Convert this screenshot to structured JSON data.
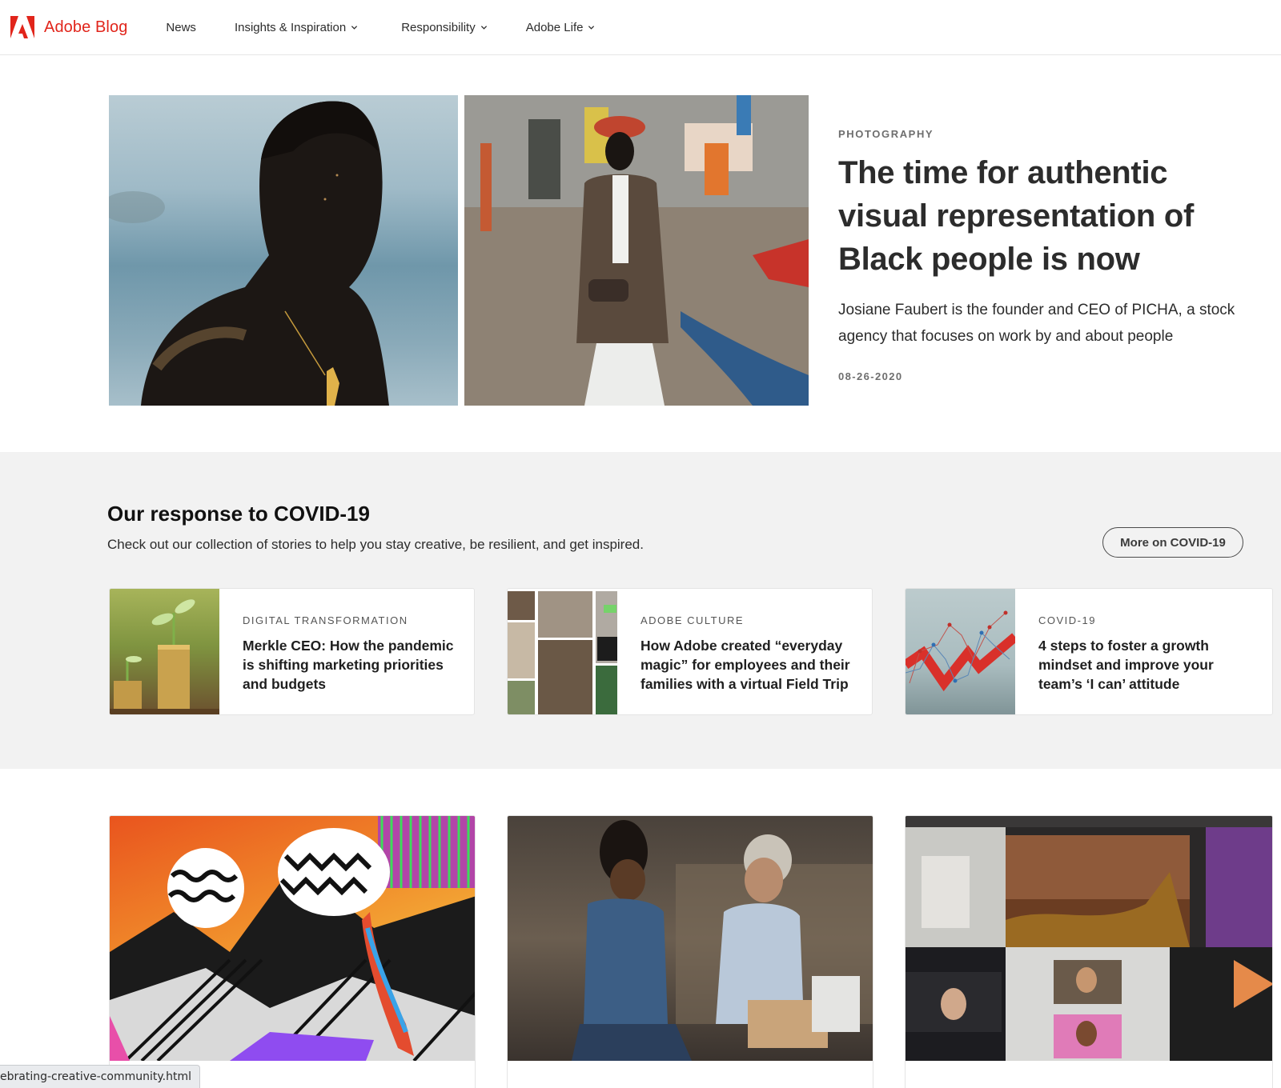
{
  "colors": {
    "brand": "#e1251b",
    "text": "#2c2c2c",
    "muted": "#6e6e6e",
    "band": "#f2f2f2"
  },
  "nav": {
    "brand": "Adobe Blog",
    "logo_icon": "adobe-logo-icon",
    "items": [
      {
        "label": "News",
        "has_dropdown": false
      },
      {
        "label": "Insights & Inspiration",
        "has_dropdown": true
      },
      {
        "label": "Responsibility",
        "has_dropdown": true
      },
      {
        "label": "Adobe Life",
        "has_dropdown": true
      }
    ]
  },
  "hero": {
    "category": "PHOTOGRAPHY",
    "title": "The time for authentic visual representation of Black people is now",
    "description": "Josiane Faubert is the founder and CEO of PICHA, a stock agency that focuses on work by and about people",
    "date": "08-26-2020",
    "images": [
      {
        "alt": "Portrait of a man with sand on his face by the sea"
      },
      {
        "alt": "Man in a brown blazer and red beret standing by a wall and boat"
      }
    ]
  },
  "covid": {
    "title": "Our response to COVID-19",
    "subtitle": "Check out our collection of stories to help you stay creative, be resilient, and get inspired.",
    "more_button": "More on COVID-19",
    "cards": [
      {
        "category": "DIGITAL TRANSFORMATION",
        "title": "Merkle CEO: How the pandemic is shifting marketing priorities and budgets",
        "thumb": "seedlings-on-coins"
      },
      {
        "category": "ADOBE CULTURE",
        "title": "How Adobe created “everyday magic” for employees and their families with a virtual Field Trip",
        "thumb": "photo-collage"
      },
      {
        "category": "COVID-19",
        "title": "4 steps to foster a growth mindset and improve your team’s ‘I can’ attitude",
        "thumb": "growth-chart"
      }
    ]
  },
  "grid": {
    "tiles": [
      {
        "thumb": "abstract-op-art-mountains"
      },
      {
        "thumb": "two-people-packing-boxes"
      },
      {
        "thumb": "video-call-creative-apps"
      }
    ]
  },
  "status_bar": {
    "url": "ebrating-creative-community.html"
  }
}
